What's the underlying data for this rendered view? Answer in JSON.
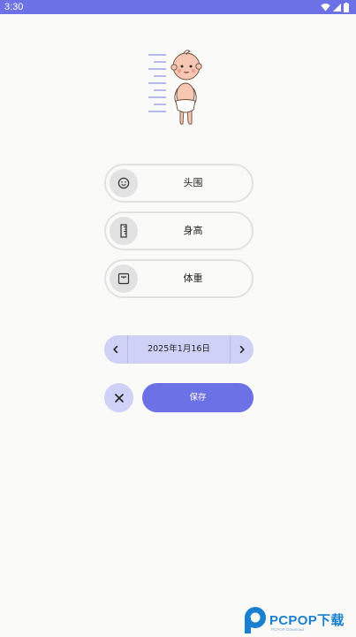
{
  "status_bar": {
    "time": "3:30"
  },
  "options": [
    {
      "label": "头围",
      "icon": "face-icon"
    },
    {
      "label": "身高",
      "icon": "ruler-icon"
    },
    {
      "label": "体重",
      "icon": "scale-icon"
    }
  ],
  "date_picker": {
    "date": "2025年1月16日"
  },
  "actions": {
    "save_label": "保存"
  },
  "watermark": {
    "brand": "PCPOP下载",
    "sub": "PCPOP Download"
  },
  "colors": {
    "accent": "#6c72e6",
    "accent_light": "#cfd2f6",
    "option_border": "#e2e2e2",
    "background": "#fafaf9"
  }
}
